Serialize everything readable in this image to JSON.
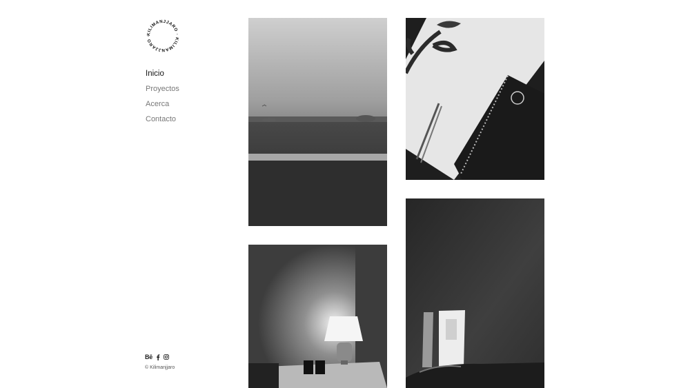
{
  "brand": {
    "logo_text": "KILIMANJJARO · KILIMANJJARO ·"
  },
  "nav": {
    "items": [
      {
        "label": "Inicio",
        "active": true
      },
      {
        "label": "Proyectos"
      },
      {
        "label": "Acerca"
      },
      {
        "label": "Contacto"
      }
    ]
  },
  "social": {
    "behance": "Bē",
    "icons": [
      "facebook-icon",
      "instagram-icon"
    ]
  },
  "footer": {
    "copyright": "© Kilimanjjaro"
  },
  "gallery": {
    "photos": [
      {
        "subject": "landscape-field"
      },
      {
        "subject": "notebook-desk"
      },
      {
        "subject": "lamp-room"
      },
      {
        "subject": "wall-light"
      }
    ]
  }
}
